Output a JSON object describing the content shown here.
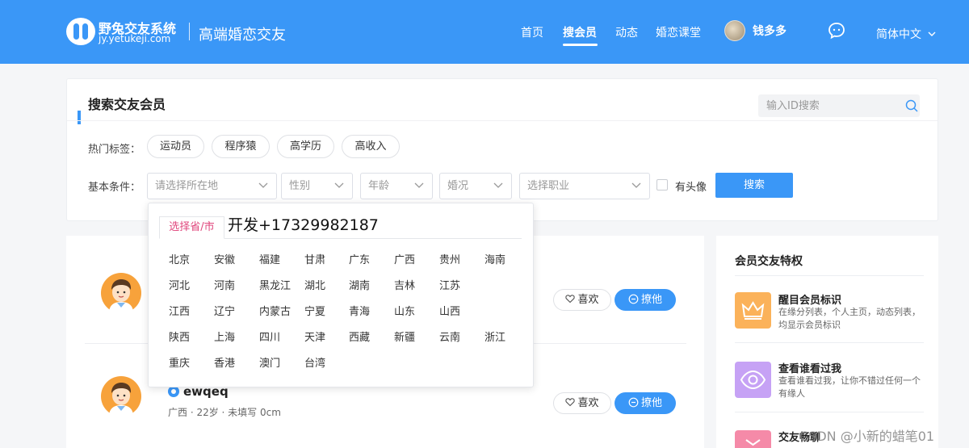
{
  "header": {
    "logo_name": "野兔交友系统",
    "logo_url": "jy.yetukeji.com",
    "slogan": "高端婚恋交友",
    "nav": [
      {
        "label": "首页",
        "active": false
      },
      {
        "label": "搜会员",
        "active": true
      },
      {
        "label": "动态",
        "active": false
      },
      {
        "label": "婚恋课堂",
        "active": false
      }
    ],
    "username": "钱多多",
    "language": "简体中文"
  },
  "search": {
    "title": "搜索交友会员",
    "id_placeholder": "输入ID搜索",
    "hot_tags_label": "热门标签：",
    "hot_tags": [
      "运动员",
      "程序猿",
      "高学历",
      "高收入"
    ],
    "basic_label": "基本条件：",
    "filters": {
      "location": "请选择所在地",
      "gender": "性别",
      "age": "年龄",
      "marital": "婚况",
      "job": "选择职业"
    },
    "has_avatar_label": "有头像",
    "search_button": "搜索"
  },
  "region_dropdown": {
    "tab": "选择省/市",
    "overlay_text": "开发+17329982187",
    "regions": [
      [
        "北京",
        "安徽",
        "福建",
        "甘肃",
        "广东",
        "广西",
        "贵州",
        "海南"
      ],
      [
        "河北",
        "河南",
        "黑龙江",
        "湖北",
        "湖南",
        "吉林",
        "江苏"
      ],
      [
        "江西",
        "辽宁",
        "内蒙古",
        "宁夏",
        "青海",
        "山东",
        "山西"
      ],
      [
        "陕西",
        "上海",
        "四川",
        "天津",
        "西藏",
        "新疆",
        "云南",
        "浙江"
      ],
      [
        "重庆",
        "香港",
        "澳门",
        "台湾"
      ]
    ]
  },
  "members": [
    {
      "name": "",
      "meta": "",
      "like_label": "喜欢",
      "flirt_label": "撩他"
    },
    {
      "name": "ewqeq",
      "meta": "广西 · 22岁 · 未填写 0cm",
      "like_label": "喜欢",
      "flirt_label": "撩他"
    }
  ],
  "privileges": {
    "title": "会员交友特权",
    "items": [
      {
        "name": "醒目会员标识",
        "desc": "在缘分列表，个人主页，动态列表，均显示会员标识",
        "color": "#fbb25a"
      },
      {
        "name": "查看谁看过我",
        "desc": "查看谁看过我，让你不错过任何一个有缘人",
        "color": "#c6a2f5"
      },
      {
        "name": "交友畅聊",
        "desc": "",
        "color": "#f58aa8"
      }
    ]
  },
  "watermark": "CSDN @小新的蜡笔01"
}
